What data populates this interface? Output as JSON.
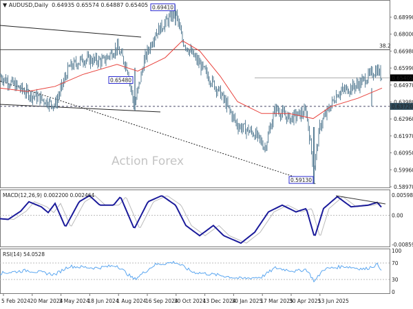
{
  "header": {
    "symbol": "AUDUSD,Daily",
    "ohlc": "0.64935 0.65574 0.64887 0.65405"
  },
  "watermark": "Action Forex",
  "colors": {
    "candle": "#5a7f96",
    "ma": "#e8423c",
    "macd": "#1a1a9a",
    "signal": "#bbbbbb",
    "rsi": "#5aa6f0",
    "box": "#2a2ad0"
  },
  "chart_data": [
    {
      "type": "candlestick",
      "title": "AUDUSD,Daily",
      "x_tick_labels": [
        "5 Feb 2024",
        "20 Mar 2024",
        "3 May 2024",
        "18 Jun 2024",
        "1 Aug 2024",
        "16 Sep 2024",
        "30 Oct 2024",
        "13 Dec 2024",
        "30 Jan 2025",
        "17 Mar 2025",
        "30 Apr 2025",
        "13 Jun 2025"
      ],
      "y_tick_labels": [
        "0.68990",
        "0.68000",
        "0.66980",
        "0.65990",
        "0.64970",
        "0.63980",
        "0.62960",
        "0.61970",
        "0.60950",
        "0.59960",
        "0.58970"
      ],
      "ylim": [
        0.5897,
        0.6899
      ],
      "close_anchors": [
        [
          0,
          0.655
        ],
        [
          20,
          0.65
        ],
        [
          40,
          0.645
        ],
        [
          80,
          0.638
        ],
        [
          100,
          0.66
        ],
        [
          120,
          0.665
        ],
        [
          150,
          0.664
        ],
        [
          170,
          0.672
        ],
        [
          185,
          0.66
        ],
        [
          195,
          0.637
        ],
        [
          210,
          0.665
        ],
        [
          225,
          0.68
        ],
        [
          255,
          0.693
        ],
        [
          265,
          0.676
        ],
        [
          290,
          0.662
        ],
        [
          320,
          0.645
        ],
        [
          345,
          0.626
        ],
        [
          370,
          0.621
        ],
        [
          385,
          0.613
        ],
        [
          400,
          0.636
        ],
        [
          420,
          0.63
        ],
        [
          445,
          0.634
        ],
        [
          456,
          0.6
        ],
        [
          465,
          0.626
        ],
        [
          490,
          0.645
        ],
        [
          520,
          0.65
        ],
        [
          548,
          0.659
        ],
        [
          555,
          0.654
        ]
      ],
      "ma_anchors": [
        [
          0,
          0.648
        ],
        [
          40,
          0.646
        ],
        [
          80,
          0.649
        ],
        [
          120,
          0.656
        ],
        [
          170,
          0.662
        ],
        [
          200,
          0.658
        ],
        [
          240,
          0.666
        ],
        [
          265,
          0.676
        ],
        [
          290,
          0.67
        ],
        [
          320,
          0.655
        ],
        [
          345,
          0.64
        ],
        [
          380,
          0.633
        ],
        [
          420,
          0.633
        ],
        [
          455,
          0.63
        ],
        [
          480,
          0.637
        ],
        [
          520,
          0.642
        ],
        [
          555,
          0.648
        ]
      ],
      "levels": [
        {
          "label": "0.69410",
          "value": 0.6941,
          "type": "high-box"
        },
        {
          "label": "0.65480",
          "value": 0.6548,
          "type": "low-box"
        },
        {
          "label": "0.59130",
          "value": 0.5913,
          "type": "low-box"
        },
        {
          "label": "38.2",
          "value": 0.6707,
          "type": "fibonacci"
        },
        {
          "label": "0.65405",
          "value": 0.65405,
          "type": "current-price"
        },
        {
          "label": "0.63720",
          "value": 0.6372,
          "type": "support"
        }
      ]
    },
    {
      "type": "line",
      "title": "MACD(12,26,9) 0.002200 0.002464",
      "y_tick_labels": [
        "0.005981",
        "0.00",
        "-0.00859"
      ],
      "ylim": [
        -0.00859,
        0.005981
      ],
      "macd_anchors": [
        [
          0,
          -0.001
        ],
        [
          12,
          -0.0012
        ],
        [
          30,
          0.0012
        ],
        [
          42,
          0.004
        ],
        [
          60,
          0.0025
        ],
        [
          70,
          0.0008
        ],
        [
          80,
          0.0035
        ],
        [
          95,
          -0.0035
        ],
        [
          115,
          0.004
        ],
        [
          130,
          0.0058
        ],
        [
          145,
          0.003
        ],
        [
          165,
          0.003
        ],
        [
          175,
          0.0055
        ],
        [
          195,
          -0.004
        ],
        [
          215,
          0.004
        ],
        [
          235,
          0.0058
        ],
        [
          255,
          0.003
        ],
        [
          270,
          -0.003
        ],
        [
          290,
          -0.006
        ],
        [
          310,
          -0.003
        ],
        [
          325,
          -0.006
        ],
        [
          350,
          -0.0082
        ],
        [
          370,
          -0.005
        ],
        [
          390,
          0.001
        ],
        [
          410,
          0.003
        ],
        [
          430,
          0.001
        ],
        [
          445,
          0.002
        ],
        [
          457,
          -0.0065
        ],
        [
          470,
          0.002
        ],
        [
          490,
          0.0055
        ],
        [
          510,
          0.0025
        ],
        [
          535,
          0.003
        ],
        [
          548,
          0.0038
        ],
        [
          555,
          0.0022
        ]
      ]
    },
    {
      "type": "line",
      "title": "RSI(14) 54.0528",
      "y_tick_labels": [
        "100",
        "70",
        "30",
        "0"
      ],
      "ylim": [
        0,
        100
      ],
      "rsi_anchors": [
        [
          0,
          45
        ],
        [
          40,
          52
        ],
        [
          80,
          42
        ],
        [
          100,
          62
        ],
        [
          140,
          58
        ],
        [
          170,
          64
        ],
        [
          195,
          30
        ],
        [
          225,
          66
        ],
        [
          255,
          72
        ],
        [
          280,
          48
        ],
        [
          320,
          40
        ],
        [
          350,
          32
        ],
        [
          380,
          36
        ],
        [
          400,
          58
        ],
        [
          430,
          50
        ],
        [
          445,
          55
        ],
        [
          457,
          25
        ],
        [
          470,
          55
        ],
        [
          500,
          62
        ],
        [
          530,
          55
        ],
        [
          548,
          66
        ],
        [
          555,
          54
        ]
      ]
    }
  ]
}
